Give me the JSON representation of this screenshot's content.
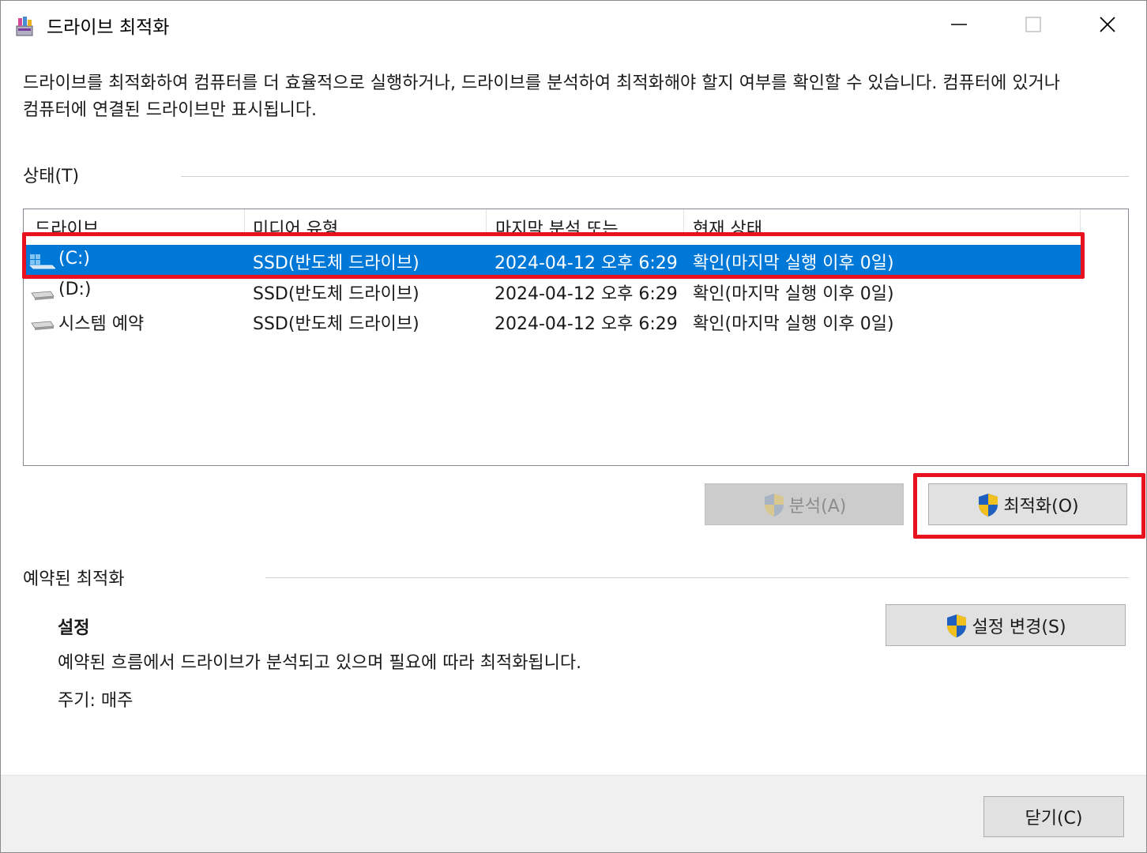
{
  "window": {
    "title": "드라이브 최적화"
  },
  "description": "드라이브를 최적화하여 컴퓨터를 더 효율적으로 실행하거나, 드라이브를 분석하여 최적화해야 할지 여부를 확인할 수 있습니다. 컴퓨터에 있거나 컴퓨터에 연결된 드라이브만 표시됩니다.",
  "status_section": {
    "label": "상태(T)",
    "columns": [
      "드라이브",
      "미디어 유형",
      "마지막 분석 또는",
      "현재 상태"
    ],
    "rows": [
      {
        "drive": "(C:)",
        "media": "SSD(반도체 드라이브)",
        "last": "2024-04-12 오후 6:29",
        "status": "확인(마지막 실행 이후 0일)",
        "icon": "windows-drive-icon",
        "selected": true
      },
      {
        "drive": "(D:)",
        "media": "SSD(반도체 드라이브)",
        "last": "2024-04-12 오후 6:29",
        "status": "확인(마지막 실행 이후 0일)",
        "icon": "drive-icon",
        "selected": false
      },
      {
        "drive": "시스템 예약",
        "media": "SSD(반도체 드라이브)",
        "last": "2024-04-12 오후 6:29",
        "status": "확인(마지막 실행 이후 0일)",
        "icon": "drive-icon",
        "selected": false
      }
    ]
  },
  "buttons": {
    "analyze": "분석(A)",
    "optimize": "최적화(O)",
    "change_settings": "설정 변경(S)",
    "close": "닫기(C)"
  },
  "scheduled": {
    "label": "예약된 최적화",
    "settings_title": "설정",
    "settings_desc": "예약된 흐름에서 드라이브가 분석되고 있으며 필요에 따라 최적화됩니다.",
    "frequency": "주기: 매주"
  },
  "colors": {
    "selection": "#0078d7",
    "highlight": "#e8121e"
  }
}
